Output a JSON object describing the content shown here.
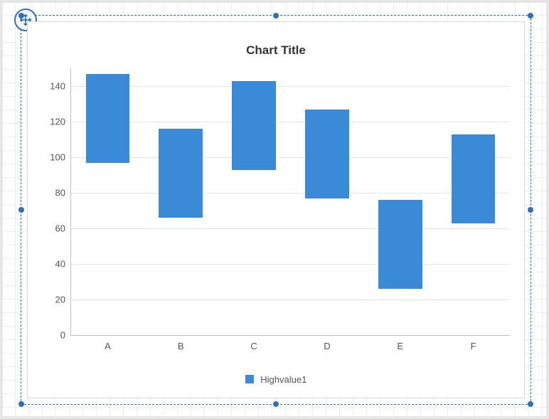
{
  "chart": {
    "title": "Chart Title",
    "legend_label": "Highvalue1"
  },
  "chart_data": {
    "type": "bar",
    "title": "Chart Title",
    "xlabel": "",
    "ylabel": "",
    "ylim": [
      0,
      150
    ],
    "y_ticks": [
      0,
      20,
      40,
      60,
      80,
      100,
      120,
      140
    ],
    "categories": [
      "A",
      "B",
      "C",
      "D",
      "E",
      "F"
    ],
    "series": [
      {
        "name": "Highvalue1",
        "low": [
          97,
          66,
          93,
          77,
          26,
          63
        ],
        "high": [
          147,
          116,
          143,
          127,
          76,
          113
        ]
      }
    ],
    "grid": true,
    "legend_position": "bottom"
  }
}
